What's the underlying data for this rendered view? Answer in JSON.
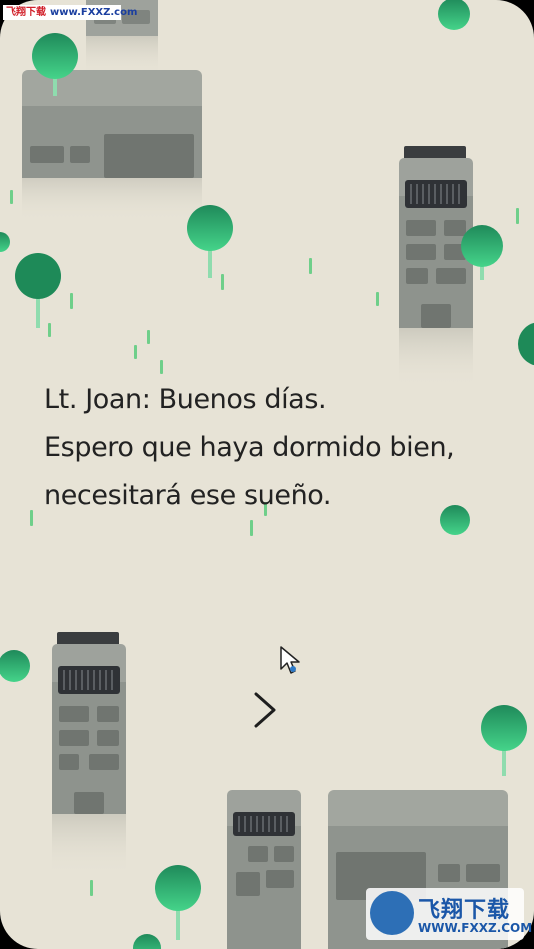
{
  "dialog": {
    "lines": [
      "Lt. Joan: Buenos días.",
      "Espero que haya dormido bien,",
      "necesitará ese sueño."
    ]
  },
  "controls": {
    "next_icon": "chevron-right"
  },
  "watermark_top": {
    "site_cn": "飞翔下载",
    "url": "www.FXXZ.com"
  },
  "watermark_bottom": {
    "site_cn": "飞翔下载",
    "url": "WWW.FXXZ.COM"
  },
  "colors": {
    "background": "#e7e3d6",
    "building": "#9ea29c",
    "building_dark": "#7f847f",
    "tree": "#3ec07b",
    "text": "#222222"
  }
}
